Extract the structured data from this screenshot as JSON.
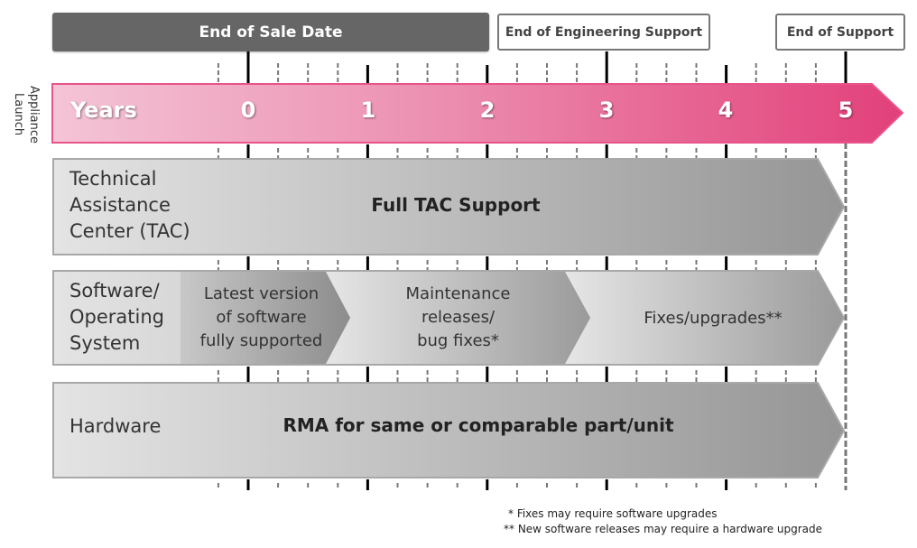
{
  "milestones": {
    "end_of_sale": "End of Sale Date",
    "end_of_engineering": "End of Engineering Support",
    "end_of_support": "End of Support"
  },
  "side_label": "Appliance Launch",
  "timeline": {
    "label": "Years",
    "years": [
      "0",
      "1",
      "2",
      "3",
      "4",
      "5"
    ],
    "color": "#e84a82"
  },
  "rows": {
    "tac": {
      "label_lines": [
        "Technical",
        "Assistance",
        "Center (TAC)"
      ],
      "text": "Full TAC Support"
    },
    "software": {
      "label_lines": [
        "Software/",
        "Operating",
        "System"
      ],
      "segments": [
        {
          "lines": [
            "Latest version",
            "of software",
            "fully supported"
          ]
        },
        {
          "lines": [
            "Maintenance",
            "releases/",
            "bug fixes*"
          ]
        },
        {
          "lines": [
            "Fixes/upgrades**"
          ]
        }
      ]
    },
    "hardware": {
      "label": "Hardware",
      "text": "RMA for same or comparable part/unit"
    }
  },
  "footnotes": [
    "* Fixes may require software upgrades",
    "** New software releases may require a hardware upgrade"
  ]
}
